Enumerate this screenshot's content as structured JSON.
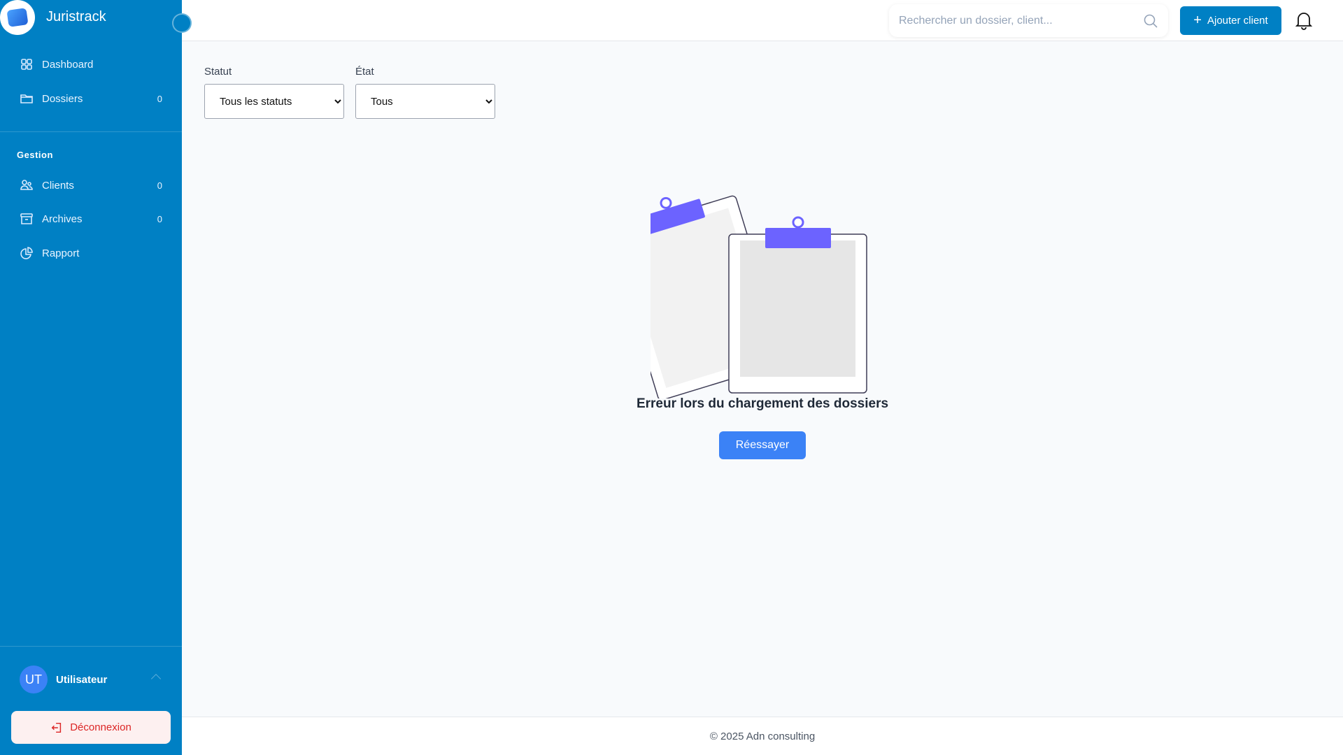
{
  "sidebar": {
    "brand": "Juristrack",
    "items": [
      {
        "label": "Dashboard",
        "count": null
      },
      {
        "label": "Dossiers",
        "count": "0"
      },
      {
        "label": "Clients",
        "count": "0"
      },
      {
        "label": "Archives",
        "count": "0"
      },
      {
        "label": "Rapport",
        "count": null
      }
    ],
    "section_label": "Gestion",
    "user": {
      "initials": "UT",
      "name": "Utilisateur"
    },
    "logout_label": "Déconnexion"
  },
  "header": {
    "search_placeholder": "Rechercher un dossier, client...",
    "add_client_label": "Ajouter client"
  },
  "filters": {
    "status": {
      "label": "Statut",
      "selected": "Tous les statuts"
    },
    "state": {
      "label": "État",
      "selected": "Tous"
    }
  },
  "main": {
    "error_message": "Erreur lors du chargement des dossiers",
    "retry_label": "Réessayer"
  },
  "footer": {
    "copyright": "© 2025 Adn consulting"
  },
  "colors": {
    "sidebar": "#0080c4",
    "accent": "#3b82f6",
    "illustration": "#6c63ff",
    "danger": "#dc2626"
  }
}
